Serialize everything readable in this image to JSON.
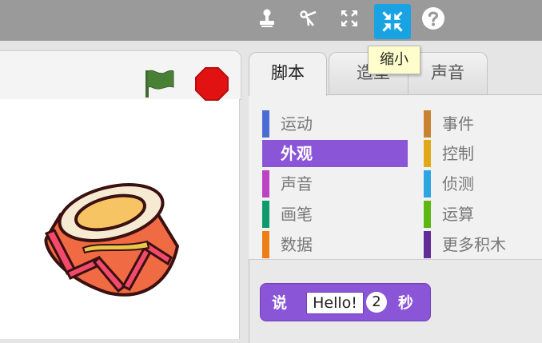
{
  "toolbar": {
    "icons": [
      "duplicate-stamp-icon",
      "cut-scissors-icon",
      "grow-arrows-icon",
      "shrink-arrows-icon",
      "help-question-icon"
    ],
    "active_icon": "shrink-arrows-icon",
    "tooltip": "缩小",
    "accent": "#1aa3e3"
  },
  "stage": {
    "controls": [
      "green-flag-icon",
      "stop-sign-icon"
    ],
    "sprite": "drum-sprite"
  },
  "tabs": [
    {
      "label": "脚本",
      "active": true
    },
    {
      "label": "造型",
      "active": false
    },
    {
      "label": "声音",
      "active": false
    }
  ],
  "categories": [
    {
      "label": "运动",
      "color": "#4a6cd4"
    },
    {
      "label": "外观",
      "color": "#8a55d7",
      "selected": true
    },
    {
      "label": "声音",
      "color": "#bb42c3"
    },
    {
      "label": "画笔",
      "color": "#0e9a6c"
    },
    {
      "label": "数据",
      "color": "#ee7d16"
    },
    {
      "label": "事件",
      "color": "#c88330"
    },
    {
      "label": "控制",
      "color": "#e1a91a"
    },
    {
      "label": "侦测",
      "color": "#2ca5e2"
    },
    {
      "label": "运算",
      "color": "#5cb712"
    },
    {
      "label": "更多积木",
      "color": "#632d99"
    }
  ],
  "block": {
    "say": "说",
    "text": "Hello!",
    "number": "2",
    "unit": "秒",
    "color": "#8a55d7"
  }
}
